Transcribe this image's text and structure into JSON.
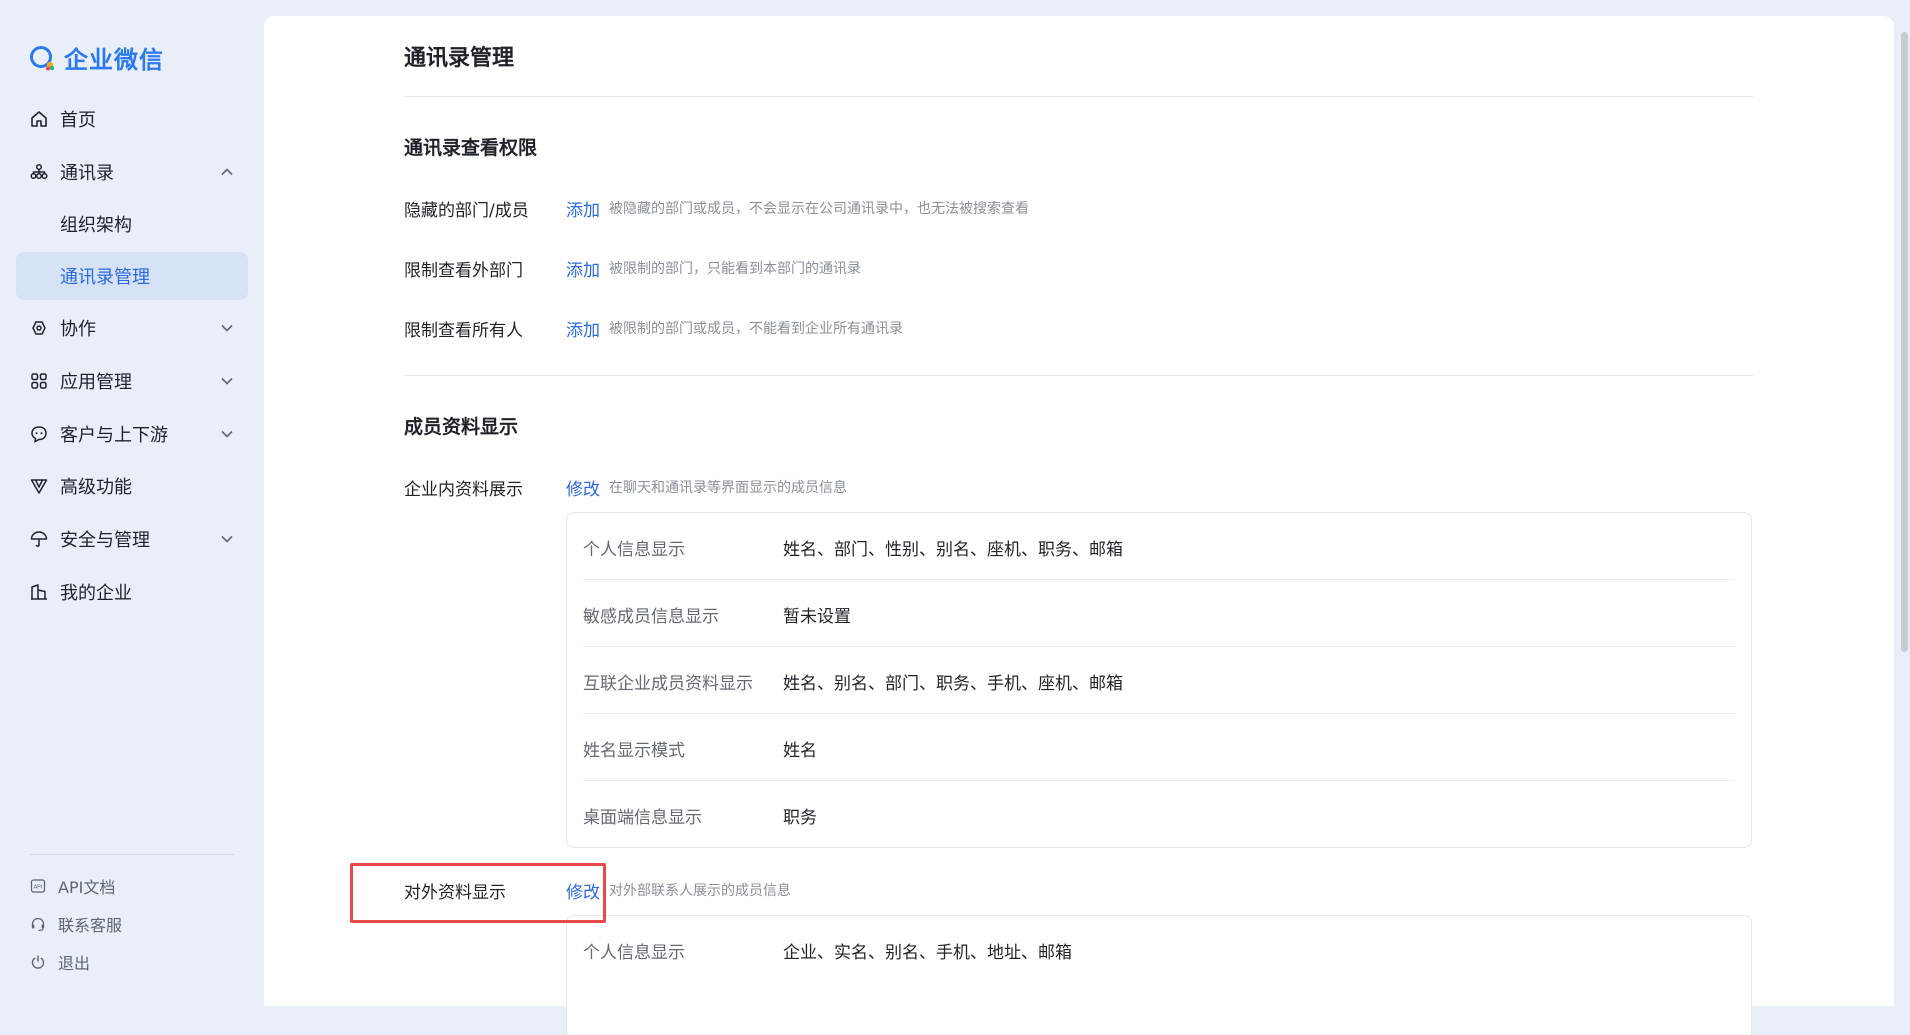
{
  "app": {
    "name": "企业微信",
    "brand_color": "#2b7bee"
  },
  "sidebar": {
    "items": [
      {
        "label": "首页",
        "icon": "home-icon"
      },
      {
        "label": "通讯录",
        "icon": "org-chart-icon",
        "expanded": true
      },
      {
        "label": "组织架构"
      },
      {
        "label": "通讯录管理",
        "active": true
      },
      {
        "label": "协作",
        "icon": "collaboration-icon"
      },
      {
        "label": "应用管理",
        "icon": "apps-grid-icon"
      },
      {
        "label": "客户与上下游",
        "icon": "customer-chat-icon"
      },
      {
        "label": "高级功能",
        "icon": "advanced-feature-icon"
      },
      {
        "label": "安全与管理",
        "icon": "umbrella-icon"
      },
      {
        "label": "我的企业",
        "icon": "building-icon"
      }
    ],
    "footer": [
      {
        "label": "API文档",
        "icon": "api-doc-icon"
      },
      {
        "label": "联系客服",
        "icon": "headset-icon"
      },
      {
        "label": "退出",
        "icon": "power-icon"
      }
    ]
  },
  "main": {
    "title": "通讯录管理",
    "view_permission": {
      "title": "通讯录查看权限",
      "rows": [
        {
          "label": "隐藏的部门/成员",
          "action": "添加",
          "hint": "被隐藏的部门或成员，不会显示在公司通讯录中，也无法被搜索查看"
        },
        {
          "label": "限制查看外部门",
          "action": "添加",
          "hint": "被限制的部门，只能看到本部门的通讯录"
        },
        {
          "label": "限制查看所有人",
          "action": "添加",
          "hint": "被限制的部门或成员，不能看到企业所有通讯录"
        }
      ]
    },
    "member_display": {
      "title": "成员资料显示",
      "internal": {
        "label": "企业内资料展示",
        "action": "修改",
        "hint": "在聊天和通讯录等界面显示的成员信息",
        "rows": [
          {
            "key": "个人信息显示",
            "value": "姓名、部门、性别、别名、座机、职务、邮箱"
          },
          {
            "key": "敏感成员信息显示",
            "value": "暂未设置"
          },
          {
            "key": "互联企业成员资料显示",
            "value": "姓名、别名、部门、职务、手机、座机、邮箱"
          },
          {
            "key": "姓名显示模式",
            "value": "姓名"
          },
          {
            "key": "桌面端信息显示",
            "value": "职务"
          }
        ]
      },
      "external": {
        "label": "对外资料显示",
        "action": "修改",
        "hint": "对外部联系人展示的成员信息",
        "rows": [
          {
            "key": "个人信息显示",
            "value": "企业、实名、别名、手机、地址、邮箱"
          }
        ]
      }
    }
  },
  "colors": {
    "link": "#2b6ad8",
    "highlight": "#e84a4a",
    "active_bg": "#d5e2f8"
  }
}
